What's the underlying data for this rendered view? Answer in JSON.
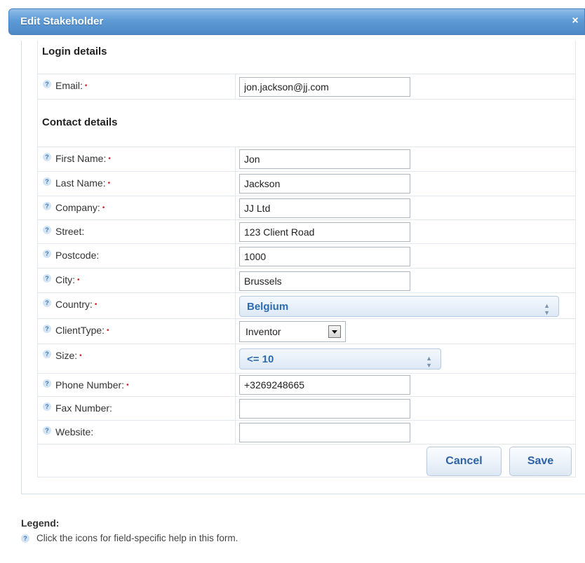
{
  "dialog": {
    "title": "Edit Stakeholder",
    "close_label": "×"
  },
  "sections": {
    "login": "Login details",
    "contact": "Contact details"
  },
  "help_glyph": "?",
  "required_marker": "•",
  "fields": {
    "email": {
      "label": "Email:",
      "value": "jon.jackson@jj.com",
      "required": true
    },
    "first_name": {
      "label": "First Name:",
      "value": "Jon",
      "required": true
    },
    "last_name": {
      "label": "Last Name:",
      "value": "Jackson",
      "required": true
    },
    "company": {
      "label": "Company:",
      "value": "JJ Ltd",
      "required": true
    },
    "street": {
      "label": "Street:",
      "value": "123 Client Road",
      "required": false
    },
    "postcode": {
      "label": "Postcode:",
      "value": "1000",
      "required": false
    },
    "city": {
      "label": "City:",
      "value": "Brussels",
      "required": true
    },
    "country": {
      "label": "Country:",
      "value": "Belgium",
      "required": true
    },
    "client_type": {
      "label": "ClientType:",
      "value": "Inventor",
      "required": true
    },
    "size": {
      "label": "Size:",
      "value": "<= 10",
      "required": true
    },
    "phone": {
      "label": "Phone Number:",
      "value": "+3269248665",
      "required": true
    },
    "fax": {
      "label": "Fax Number:",
      "value": "",
      "required": false
    },
    "website": {
      "label": "Website:",
      "value": "",
      "required": false
    }
  },
  "buttons": {
    "cancel": "Cancel",
    "save": "Save"
  },
  "legend": {
    "title": "Legend:",
    "text": "Click the icons for field-specific help in this form."
  },
  "colors": {
    "accent": "#4c88c6",
    "required": "#d32020",
    "link": "#2e62a6"
  },
  "icons": {
    "help": "help-icon",
    "close": "close-icon",
    "select_arrows": "updown-arrows-icon",
    "dropdown": "dropdown-arrow-icon"
  }
}
